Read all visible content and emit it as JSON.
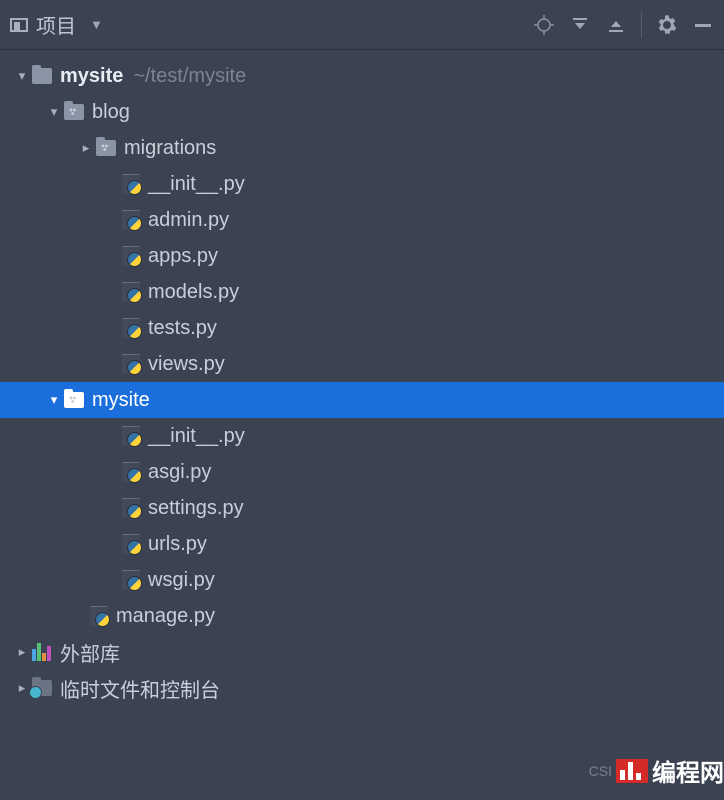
{
  "toolbar": {
    "title": "项目"
  },
  "tree": {
    "root": {
      "name": "mysite",
      "path": "~/test/mysite"
    },
    "blog": {
      "name": "blog"
    },
    "migrations": {
      "name": "migrations"
    },
    "blog_files": {
      "init": "__init__.py",
      "admin": "admin.py",
      "apps": "apps.py",
      "models": "models.py",
      "tests": "tests.py",
      "views": "views.py"
    },
    "mysite_pkg": {
      "name": "mysite"
    },
    "mysite_files": {
      "init": "__init__.py",
      "asgi": "asgi.py",
      "settings": "settings.py",
      "urls": "urls.py",
      "wsgi": "wsgi.py"
    },
    "manage": "manage.py",
    "external": "外部库",
    "scratch": "临时文件和控制台"
  },
  "watermark": {
    "csdn": "CSI",
    "text": "编程网"
  }
}
